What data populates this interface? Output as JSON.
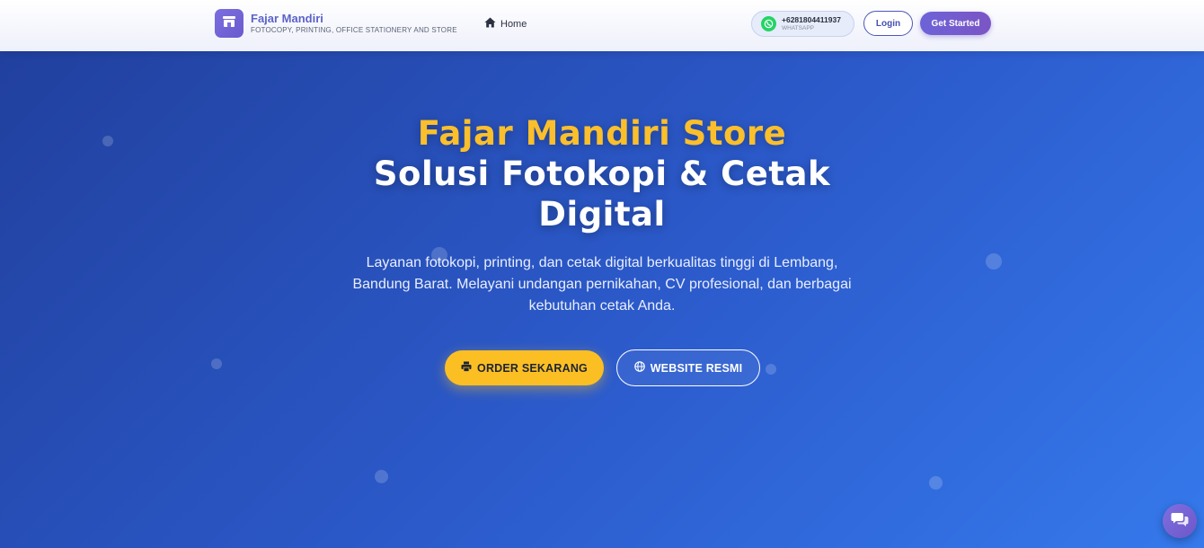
{
  "header": {
    "brand_name": "Fajar Mandiri",
    "brand_tagline": "FOTOCOPY, PRINTING, OFFICE STATIONERY AND STORE",
    "logo_icon": "store-icon",
    "nav": [
      {
        "label": "Home",
        "icon": "home-icon"
      }
    ],
    "whatsapp": {
      "number": "+6281804411937",
      "label": "WHATSAPP",
      "icon": "whatsapp-icon"
    },
    "login_label": "Login",
    "get_started_label": "Get Started"
  },
  "hero": {
    "title_line1": "Fajar Mandiri Store",
    "title_line2": "Solusi Fotokopi & Cetak Digital",
    "description": "Layanan fotokopi, printing, dan cetak digital berkualitas tinggi di Lembang, Bandung Barat. Melayani undangan pernikahan, CV profesional, dan berbagai kebutuhan cetak Anda.",
    "primary_button": {
      "label": "ORDER SEKARANG",
      "icon": "printer-icon"
    },
    "secondary_button": {
      "label": "WEBSITE RESMI",
      "icon": "globe-icon"
    }
  },
  "chat_widget": {
    "icon": "chat-icon"
  },
  "colors": {
    "accent_yellow": "#fbbf24",
    "brand_purple": "#6a5acd",
    "hero_blue": "#2c5bcc",
    "whatsapp_green": "#25d366"
  }
}
